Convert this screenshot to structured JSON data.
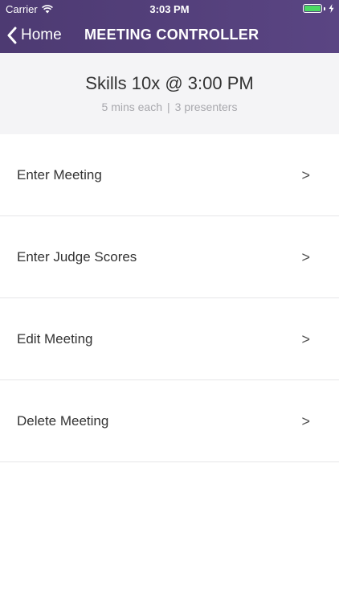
{
  "status_bar": {
    "carrier": "Carrier",
    "time": "3:03 PM",
    "battery_color": "#4cd964"
  },
  "nav": {
    "back_label": "Home",
    "title": "MEETING CONTROLLER",
    "background": "#4d3a72"
  },
  "summary": {
    "title": "Skills 10x @ 3:00 PM",
    "duration": "5 mins each",
    "separator": "|",
    "presenters": "3 presenters"
  },
  "menu": {
    "items": [
      {
        "label": "Enter Meeting",
        "arrow": ">"
      },
      {
        "label": "Enter Judge Scores",
        "arrow": ">"
      },
      {
        "label": "Edit Meeting",
        "arrow": ">"
      },
      {
        "label": "Delete Meeting",
        "arrow": ">"
      }
    ]
  }
}
